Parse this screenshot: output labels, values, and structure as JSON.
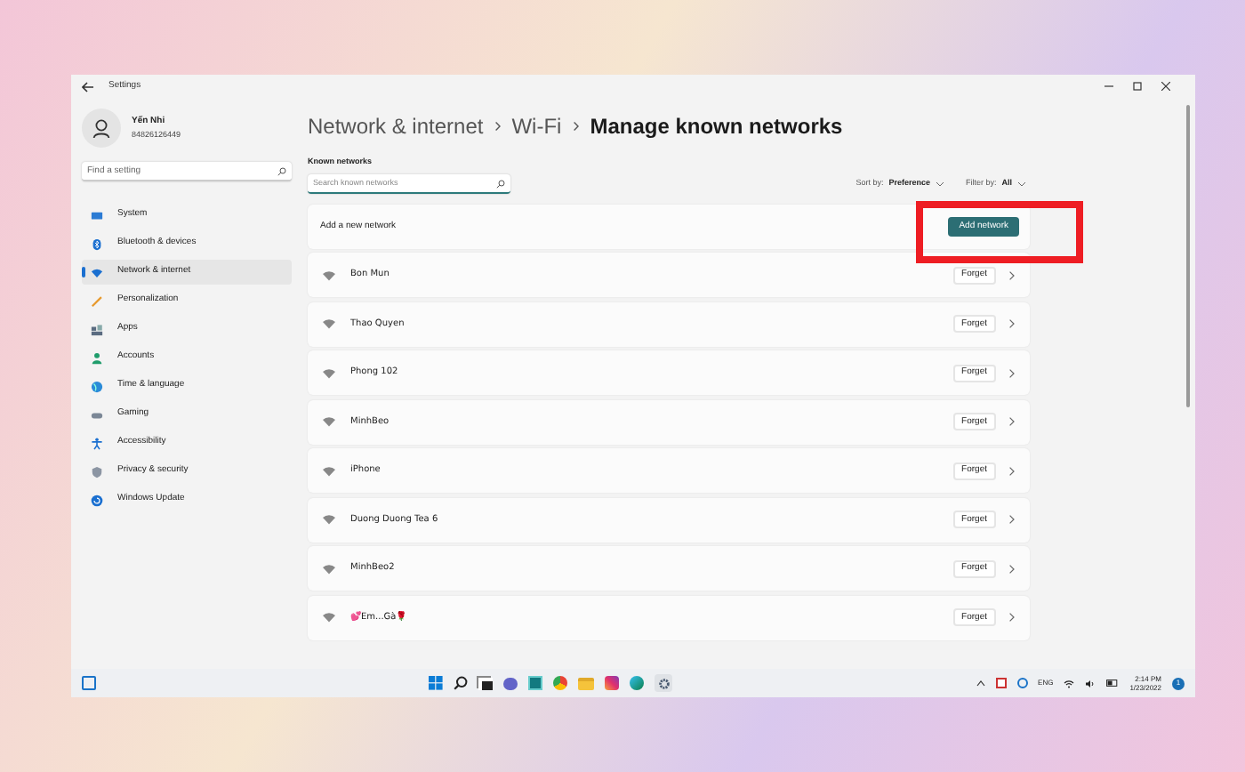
{
  "window": {
    "title": "Settings"
  },
  "user": {
    "name": "Yến Nhi",
    "phone": "84826126449"
  },
  "sidebar": {
    "search": {
      "placeholder": "Find a setting"
    },
    "items": [
      {
        "label": "System",
        "kind": "system",
        "selected": false
      },
      {
        "label": "Bluetooth & devices",
        "kind": "bluetooth",
        "selected": false
      },
      {
        "label": "Network & internet",
        "kind": "network",
        "selected": true
      },
      {
        "label": "Personalization",
        "kind": "pen",
        "selected": false
      },
      {
        "label": "Apps",
        "kind": "apps",
        "selected": false
      },
      {
        "label": "Accounts",
        "kind": "accounts",
        "selected": false
      },
      {
        "label": "Time & language",
        "kind": "globe",
        "selected": false
      },
      {
        "label": "Gaming",
        "kind": "gaming",
        "selected": false
      },
      {
        "label": "Accessibility",
        "kind": "accessibility",
        "selected": false
      },
      {
        "label": "Privacy & security",
        "kind": "shield",
        "selected": false
      },
      {
        "label": "Windows Update",
        "kind": "update",
        "selected": false
      }
    ]
  },
  "breadcrumb": [
    {
      "label": "Network & internet"
    },
    {
      "label": "Wi-Fi"
    },
    {
      "label": "Manage known networks"
    }
  ],
  "section_title": "Known networks",
  "search": {
    "placeholder": "Search known networks"
  },
  "sort": {
    "label": "Sort by:",
    "value": "Preference"
  },
  "filter": {
    "label": "Filter by:",
    "value": "All"
  },
  "add_row": {
    "label": "Add a new network",
    "button": "Add network",
    "highlighted": true
  },
  "networks": [
    {
      "name": "Bon Mun",
      "button": "Forget"
    },
    {
      "name": "Thao Quyen",
      "button": "Forget"
    },
    {
      "name": "Phong 102",
      "button": "Forget"
    },
    {
      "name": "MinhBeo",
      "button": "Forget"
    },
    {
      "name": "iPhone",
      "button": "Forget"
    },
    {
      "name": "Duong Duong Tea 6",
      "button": "Forget"
    },
    {
      "name": "MinhBeo2",
      "button": "Forget"
    },
    {
      "name": "💕Em...Gà🌹",
      "button": "Forget"
    }
  ],
  "taskbar": {
    "language": "ENG",
    "time": "2:14 PM",
    "date": "1/23/2022",
    "badge": "1"
  }
}
